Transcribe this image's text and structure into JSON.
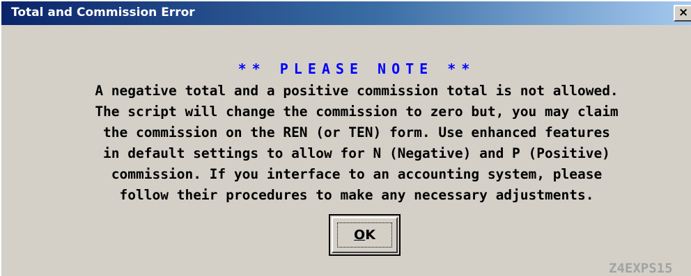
{
  "window": {
    "title": "Total and Commission Error",
    "close_label": "×"
  },
  "notice": {
    "heading": "** PLEASE NOTE **",
    "lines": [
      "A negative total and a positive commission total is not allowed.",
      "The script will change the commission to zero but, you may claim",
      "the commission on the REN (or TEN) form. Use enhanced features",
      "in default settings to allow for N (Negative) and P (Positive)",
      "commission. If you interface to an accounting system, please",
      "follow their procedures to make any necessary adjustments."
    ]
  },
  "ok_button": {
    "mnemonic": "O",
    "rest": "K"
  },
  "form_code": "Z4EXPS15",
  "colors": {
    "heading": "#0000ff",
    "form_code": "#a3a3a3",
    "titlebar_start": "#0a246a",
    "dialog_bg": "#d4d0c8"
  }
}
